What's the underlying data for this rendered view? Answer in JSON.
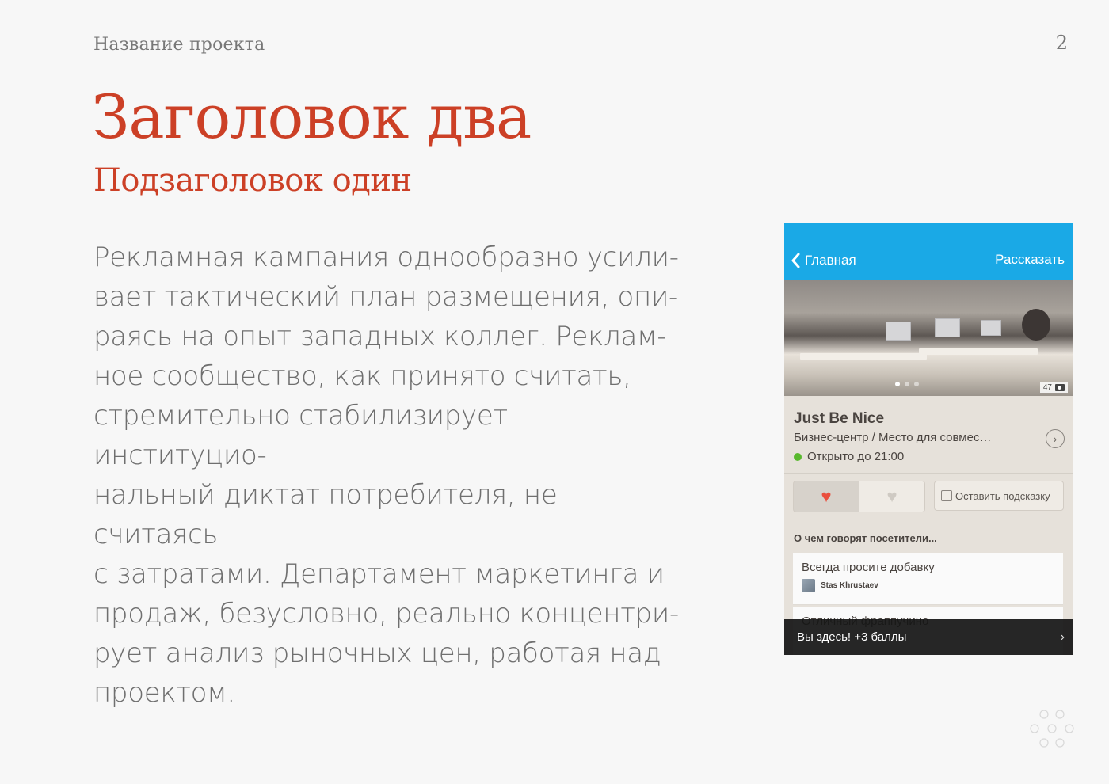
{
  "header": {
    "project_name": "Название проекта",
    "page_number": "2"
  },
  "title": "Заголовок два",
  "subtitle": "Подзаголовок один",
  "body_lines": [
    "Рекламная кампания однообразно усили-",
    "вает тактический план размещения, опи-",
    "раясь на опыт западных коллег. Реклам-",
    "ное сообщество, как принято считать,",
    "стремительно стабилизирует институцио-",
    "нальный диктат потребителя, не считаясь",
    "с затратами. Департамент маркетинга и",
    "продаж, безусловно, реально концентри-",
    "рует анализ рыночных цен, работая над",
    "проектом."
  ],
  "phone": {
    "nav": {
      "back_label": "Главная",
      "action_label": "Рассказать",
      "back_icon": "chevron-left-icon",
      "color": "#1aa9e6"
    },
    "photo": {
      "count": "47",
      "count_icon": "camera-icon",
      "dots_total": 3,
      "dots_active": 1
    },
    "venue": {
      "name": "Just Be Nice",
      "category": "Бизнес-центр / Место для совмес…",
      "status": "Открыто до 21:00",
      "status_color": "#58b82d"
    },
    "actions": {
      "like_icon": "heart-icon",
      "dislike_icon": "broken-heart-icon",
      "tip_label": "Оставить подсказку"
    },
    "tips_heading": "О чем говорят посетители...",
    "tips": [
      {
        "text": "Всегда просите добавку",
        "author": "Stas Khrustaev"
      },
      {
        "text": "Отличный фраппучино",
        "author": ""
      }
    ],
    "banner": {
      "text": "Вы здесь! +3 баллы"
    }
  },
  "colors": {
    "accent": "#cc4026",
    "text": "#6f6f6f",
    "background": "#f7f7f7"
  }
}
